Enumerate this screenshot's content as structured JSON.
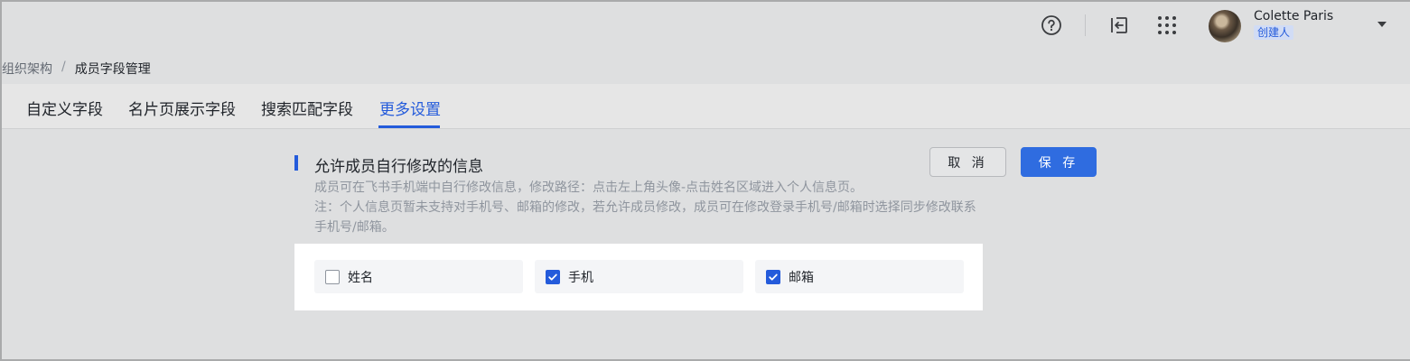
{
  "header": {
    "help_icon": "help-circle-icon",
    "exit_icon": "exit-admin-icon",
    "apps_icon": "app-grid-icon",
    "user": {
      "name": "Colette Paris",
      "role": "创建人"
    },
    "dropdown_icon": "chevron-down-icon"
  },
  "breadcrumb": {
    "parent": "组织架构",
    "separator": "/",
    "current": "成员字段管理"
  },
  "tabs": [
    {
      "label": "自定义字段"
    },
    {
      "label": "名片页展示字段"
    },
    {
      "label": "搜索匹配字段"
    },
    {
      "label": "更多设置",
      "active": true
    }
  ],
  "section": {
    "title": "允许成员自行修改的信息",
    "desc_line1": "成员可在飞书手机端中自行修改信息，修改路径：点击左上角头像-点击姓名区域进入个人信息页。",
    "desc_note": "注：个人信息页暂未支持对手机号、邮箱的修改，若允许成员修改，成员可在修改登录手机号/邮箱时选择同步修改联系手机号/邮箱。"
  },
  "actions": {
    "cancel_label": "取 消",
    "save_label": "保 存"
  },
  "options": [
    {
      "label": "姓名",
      "checked": false
    },
    {
      "label": "手机",
      "checked": true
    },
    {
      "label": "邮箱",
      "checked": true
    }
  ],
  "colors": {
    "accent": "#245bdb",
    "save_button": "#2f6ce0",
    "page_bg": "#dedfe0",
    "card_bg": "#ffffff"
  }
}
